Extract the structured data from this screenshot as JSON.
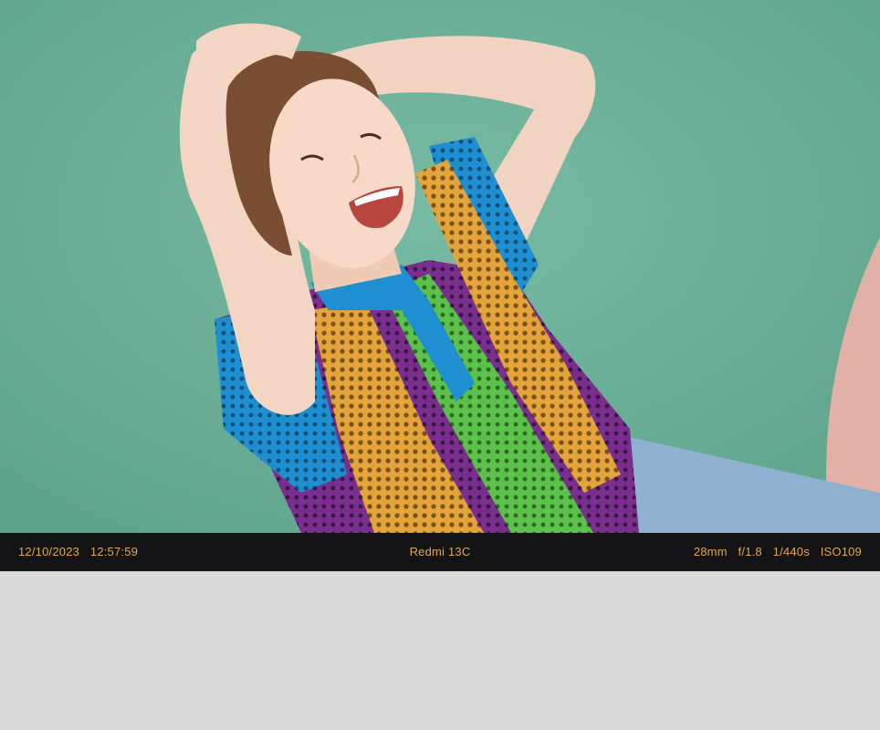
{
  "watermark": {
    "date": "12/10/2023",
    "time": "12:57:59",
    "device": "Redmi 13C",
    "focal_length": "28mm",
    "aperture": "f/1.8",
    "shutter": "1/440s",
    "iso": "ISO109"
  },
  "colors": {
    "background": "#d9d9d9",
    "bar_background": "#141416",
    "bar_text": "#e0a84e",
    "ground": "#6fb49d",
    "track": "#e3b0a8"
  },
  "photo": {
    "subject": "laughing-person-colorful-knit-shirt"
  }
}
